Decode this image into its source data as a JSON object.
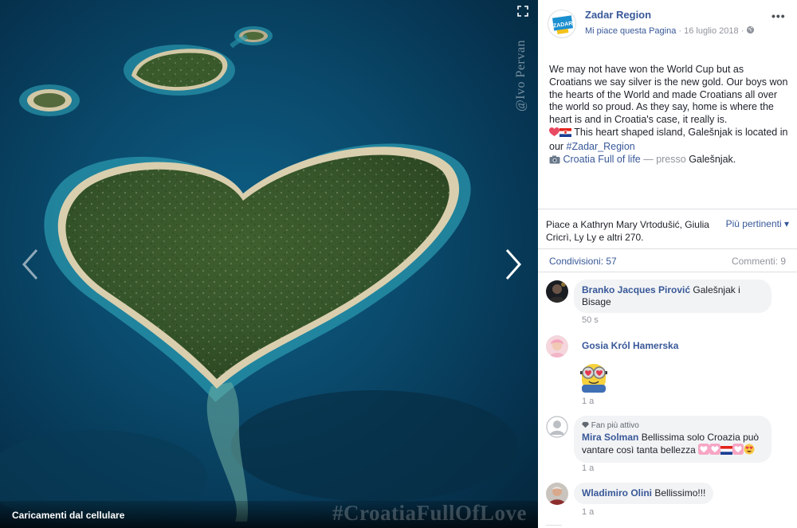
{
  "photo": {
    "credit_watermark": "@Ivo Pervan",
    "bottom_caption": "Caricamenti dal cellulare",
    "hashtag_watermark": "#CroatiaFullOfLove",
    "icons": {
      "prev": "chevron-left-icon",
      "next": "chevron-right-icon",
      "expand": "expand-icon"
    }
  },
  "post": {
    "page_name": "Zadar Region",
    "avatar_text": "ZADAR",
    "like_page": "Mi piace questa Pagina",
    "separator": " · ",
    "date": "16 luglio 2018",
    "audience_icon": "globe-icon",
    "options_icon": "•••",
    "text_main": "We may not have won the World Cup but as Croatians we say silver is the new gold. Our boys won the hearts of the World and made Croatians all over the world so proud. As they say, home is where the heart is and in Croatia's case, it really is.",
    "text_island": " This heart shaped island, Galešnjak is located in our ",
    "hashtag": "#Zadar_Region",
    "album_link": "Croatia Full of life",
    "at_text": " — presso ",
    "place": "Galešnjak",
    "period": "."
  },
  "stats": {
    "likes_summary": "Piace a Kathryn Mary Vrtodušić, Giulia Cricrì, Ly Ly e altri 270.",
    "sort_label": "Più pertinenti ▾",
    "shares": "Condivisioni: 57",
    "comments": "Commenti: 9"
  },
  "comments": [
    {
      "author": "Branko Jacques Pirović",
      "text": " Galešnjak i Bisage",
      "time": "50 s"
    },
    {
      "author": "Gosia Król Hamerska",
      "text": "",
      "time": "1 a"
    },
    {
      "badge": "Fan più attivo",
      "author": "Mira Solman",
      "text": " Bellissima solo Croazia può vantare così tanta bellezza ",
      "time": "1 a"
    },
    {
      "author": "Wladimiro Olini",
      "text": " Bellissimo!!!",
      "time": "1 a"
    }
  ],
  "colors": {
    "link": "#385898",
    "muted": "#90949c",
    "bubble": "#f2f3f5",
    "sea": "#0a4a6c"
  }
}
